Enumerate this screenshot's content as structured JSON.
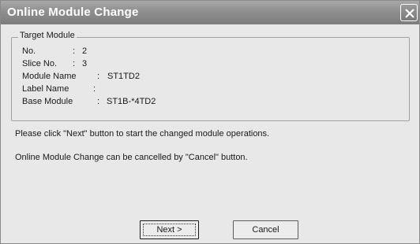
{
  "window": {
    "title": "Online Module Change"
  },
  "target_module": {
    "legend": "Target Module",
    "fields": [
      {
        "label": "No.",
        "value": "2"
      },
      {
        "label": "Slice No.",
        "value": "3"
      },
      {
        "label": "Module Name",
        "value": "ST1TD2"
      },
      {
        "label": "Label Name",
        "value": ""
      },
      {
        "label": "Base Module",
        "value": "ST1B-*4TD2"
      }
    ]
  },
  "messages": {
    "line1": "Please click \"Next\" button to start the changed module operations.",
    "line2": "Online Module Change can be cancelled by \"Cancel\" button."
  },
  "buttons": {
    "next_label": "Next >",
    "cancel_label": "Cancel"
  },
  "icons": {
    "close": "close-icon"
  },
  "colors": {
    "titlebar": "#8f8f8f",
    "dialog_bg": "#e8e8e8"
  }
}
